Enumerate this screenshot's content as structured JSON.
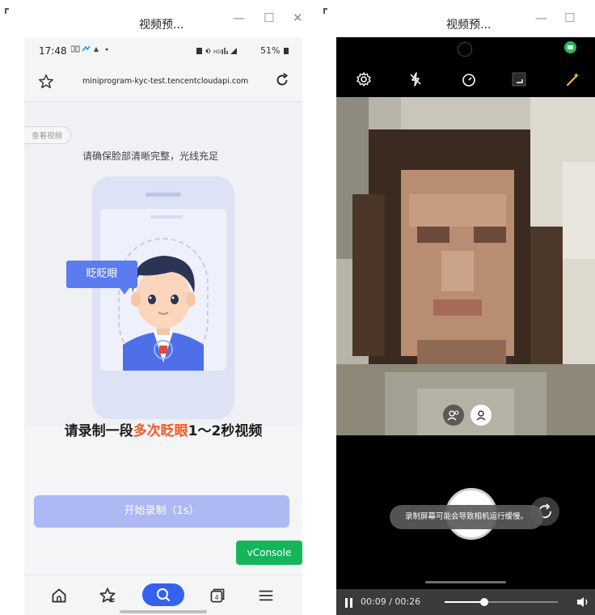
{
  "left_window": {
    "title": "视频预...",
    "controls": {
      "minimize": "—",
      "maximize": "☐",
      "close": "✕"
    }
  },
  "right_window": {
    "title": "视频预...",
    "controls": {
      "minimize": "—",
      "maximize": "☐"
    }
  },
  "phone_left": {
    "status_bar": {
      "time": "17:48",
      "right": "51%"
    },
    "url_bar": {
      "url": "miniprogram-kyc-test.tencentcloudapi.com",
      "star_icon": "star-icon",
      "reload_icon": "reload-icon"
    },
    "content": {
      "pill_label": "查看视频",
      "instruction": "请确保脸部清晰完整，光线充足",
      "blink_tag": "眨眨眼",
      "headline_pre": "请录制一段",
      "headline_highlight": "多次眨眼",
      "headline_post": "1～2秒视频",
      "start_button": "开始录制（1s）",
      "vconsole": "vConsole"
    },
    "nav": {
      "items": [
        {
          "name": "home-icon"
        },
        {
          "name": "favorite-icon"
        },
        {
          "name": "search-icon"
        },
        {
          "name": "tabs-icon"
        },
        {
          "name": "menu-icon"
        }
      ]
    },
    "colors": {
      "accent": "#3561f0",
      "highlight": "#f05a28",
      "button": "#aeb9f3",
      "vconsole": "#14b65a"
    }
  },
  "phone_right": {
    "toolbar": [
      "settings-icon",
      "flash-off-icon",
      "timer-icon",
      "aspect-icon",
      "magic-icon"
    ],
    "toast": "录制屏幕可能会导致相机运行缓慢。",
    "player": {
      "time": "00:09 / 00:26",
      "progress": 0.35
    },
    "colors": {
      "record_indicator": "#1fbf55"
    }
  }
}
